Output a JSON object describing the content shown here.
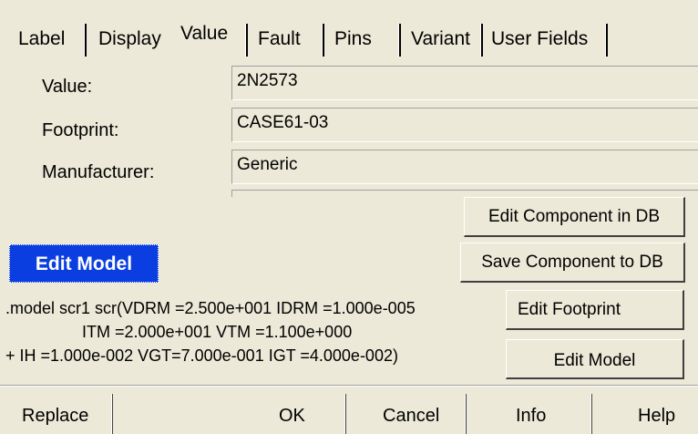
{
  "tabs": [
    {
      "label": "Label"
    },
    {
      "label": "Display"
    },
    {
      "label": "Value"
    },
    {
      "label": "Fault"
    },
    {
      "label": "Pins"
    },
    {
      "label": "Variant"
    },
    {
      "label": "User Fields"
    }
  ],
  "active_tab": "Value",
  "fields": {
    "value": {
      "label": "Value:",
      "text": "2N2573"
    },
    "footprint": {
      "label": "Footprint:",
      "text": "CASE61-03"
    },
    "manufacturer": {
      "label": "Manufacturer:",
      "text": "Generic"
    },
    "extra": {
      "text": ""
    }
  },
  "buttons": {
    "edit_component_db": "Edit Component in DB",
    "save_component_db": "Save Component to DB",
    "edit_footprint": "Edit Footprint",
    "edit_model": "Edit Model"
  },
  "edit_model_badge": "Edit Model",
  "model_text": {
    "line1": ".model scr1 scr(VDRM =2.500e+001 IDRM =1.000e-005",
    "line2": "ITM =2.000e+001 VTM =1.100e+000",
    "line3": "+ IH =1.000e-002 VGT=7.000e-001 IGT =4.000e-002)"
  },
  "bottom_bar": {
    "replace": "Replace",
    "ok": "OK",
    "cancel": "Cancel",
    "info": "Info",
    "help": "Help"
  },
  "colors": {
    "background": "#ece9d8",
    "badge_blue": "#0a3ee0"
  }
}
